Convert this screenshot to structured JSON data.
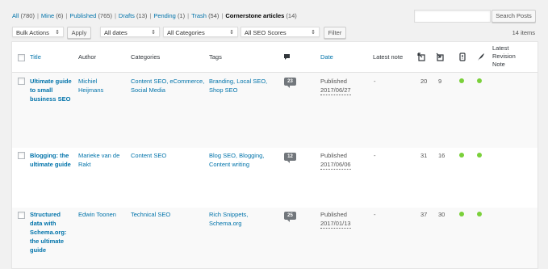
{
  "views": {
    "all": "All",
    "all_count": "(780)",
    "mine": "Mine",
    "mine_count": "(6)",
    "published": "Published",
    "published_count": "(765)",
    "drafts": "Drafts",
    "drafts_count": "(13)",
    "pending": "Pending",
    "pending_count": "(1)",
    "trash": "Trash",
    "trash_count": "(54)",
    "cornerstone": "Cornerstone articles",
    "cornerstone_count": "(14)"
  },
  "search": {
    "button": "Search Posts",
    "value": ""
  },
  "filters": {
    "bulk_actions": "Bulk Actions",
    "apply": "Apply",
    "dates": "All dates",
    "categories": "All Categories",
    "seo_scores": "All SEO Scores",
    "filter": "Filter"
  },
  "items_count": "14 items",
  "columns": {
    "title": "Title",
    "author": "Author",
    "categories": "Categories",
    "tags": "Tags",
    "date": "Date",
    "latest_note": "Latest note",
    "latest_revision": "Latest Revision Note",
    "icons": [
      "comments-icon",
      "outgoing-links-icon",
      "incoming-links-icon",
      "seo-score-icon",
      "readability-icon"
    ]
  },
  "rows": [
    {
      "title": "Ultimate guide to small business SEO",
      "author": "Michiel Heijmans",
      "categories": "Content SEO, eCommerce, Social Media",
      "tags": "Branding, Local SEO, Shop SEO",
      "comments": "23",
      "status": "Published",
      "date": "2017/06/27",
      "latest_note": "-",
      "links_out": "20",
      "links_in": "9",
      "seo_color": "#7ad03a",
      "readability_color": "#7ad03a"
    },
    {
      "title": "Blogging: the ultimate guide",
      "author": "Marieke van de Rakt",
      "categories": "Content SEO",
      "tags": "Blog SEO, Blogging, Content writing",
      "comments": "12",
      "status": "Published",
      "date": "2017/06/06",
      "latest_note": "-",
      "links_out": "31",
      "links_in": "16",
      "seo_color": "#7ad03a",
      "readability_color": "#7ad03a"
    },
    {
      "title": "Structured data with Schema.org: the ultimate guide",
      "author": "Edwin Toonen",
      "categories": "Technical SEO",
      "tags": "Rich Snippets, Schema.org",
      "comments": "25",
      "status": "Published",
      "date": "2017/01/13",
      "latest_note": "-",
      "links_out": "37",
      "links_in": "30",
      "seo_color": "#7ad03a",
      "readability_color": "#7ad03a"
    }
  ]
}
